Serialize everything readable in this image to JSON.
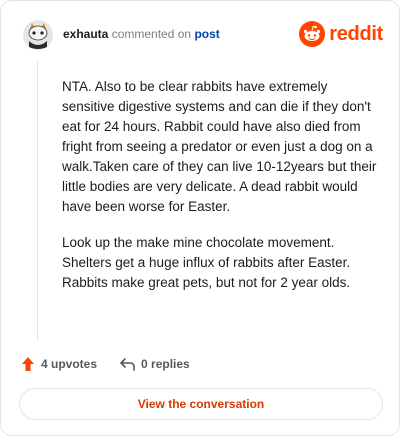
{
  "header": {
    "username": "exhauta",
    "action_text": "commented on",
    "post_link_text": "post",
    "logo_text": "reddit"
  },
  "comment": {
    "paragraphs": [
      "NTA. Also to be clear rabbits have extremely sensitive digestive systems and can die if they don't eat for 24 hours. Rabbit could have also died from fright from seeing a predator or even just a dog on a walk.Taken care of they can live 10-12years but their little bodies are very delicate. A dead rabbit would have been worse for Easter.",
      "Look up the make mine chocolate movement. Shelters get a huge influx of rabbits after Easter. Rabbits make great pets, but not for 2 year olds."
    ]
  },
  "footer": {
    "upvotes_label": "4 upvotes",
    "replies_label": "0 replies",
    "view_button_label": "View the conversation"
  },
  "colors": {
    "brand": "#ff4500",
    "link": "#0045ac",
    "cta": "#d93a00"
  },
  "icons": {
    "avatar": "snoo-avatar-icon",
    "upvote": "upvote-arrow-icon",
    "reply": "reply-arrow-icon",
    "logo": "reddit-snoo-icon"
  }
}
